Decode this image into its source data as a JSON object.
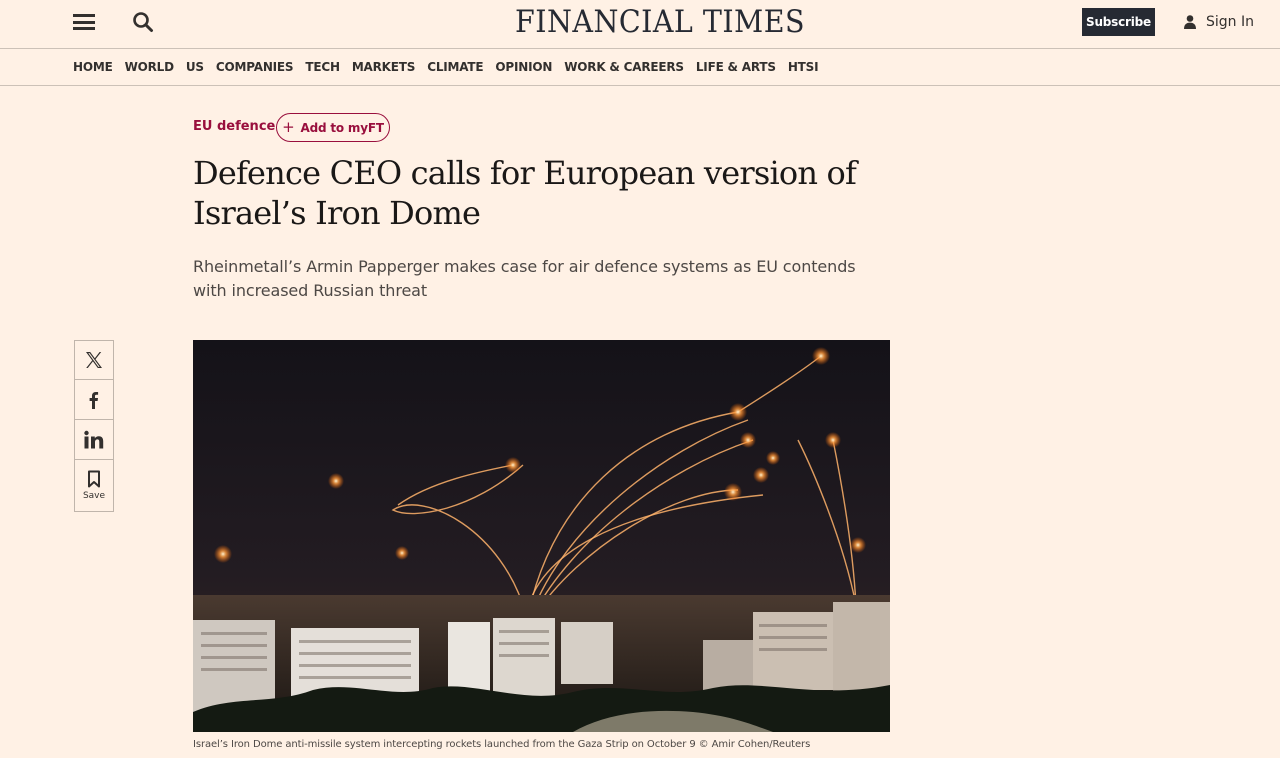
{
  "header": {
    "masthead": "FINANCIAL TIMES",
    "subscribe_label": "Subscribe",
    "signin_label": "Sign In"
  },
  "nav": {
    "items": [
      "HOME",
      "WORLD",
      "US",
      "COMPANIES",
      "TECH",
      "MARKETS",
      "CLIMATE",
      "OPINION",
      "WORK & CAREERS",
      "LIFE & ARTS",
      "HTSI"
    ]
  },
  "article": {
    "topic": "EU defence",
    "add_myft_label": "Add to myFT",
    "headline": "Defence CEO calls for European version of Israel’s Iron Dome",
    "standfirst": "Rheinmetall’s Armin Papperger makes case for air defence systems as EU contends with increased Russian threat",
    "image_caption": "Israel’s Iron Dome anti-missile system intercepting rockets launched from the Gaza Strip on October 9 © Amir Cohen/Reuters"
  },
  "share": {
    "save_label": "Save",
    "icons": [
      "x-icon",
      "facebook-icon",
      "linkedin-icon",
      "bookmark-icon"
    ]
  },
  "colors": {
    "background": "#fff1e5",
    "claret": "#990f3d",
    "dark": "#262a33"
  }
}
